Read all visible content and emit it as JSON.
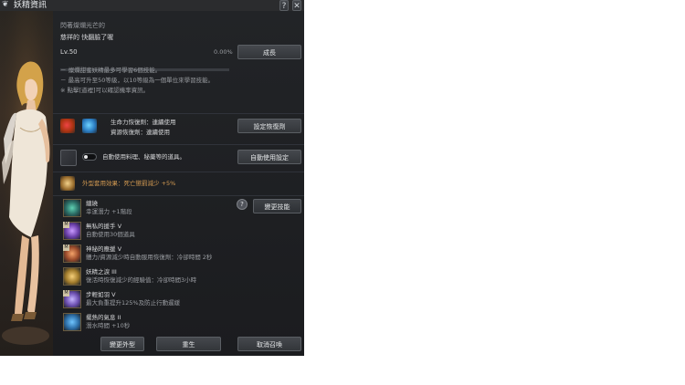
{
  "window": {
    "title": "妖精資訊",
    "help_label": "?",
    "close_label": "✕"
  },
  "header": {
    "line1": "閃著燦爛光芒的",
    "line2": "慈祥的 快翻臉了喔",
    "level": "Lv.50",
    "exp_percent": "0.00%",
    "exp_fraction": 0.0,
    "grow_button": "成長"
  },
  "info_lines": [
    "－ 燦爛甜蜜妖精最多可學習6個技能。",
    "－ 最高可升至50等級，以10等級為一個單位來學習技能。",
    "※ 點擊[道裡]可以確認機率資訊。"
  ],
  "potion": {
    "hp_label": "生命力恢復劑：連續使用",
    "mp_label": "資源恢復劑：連續使用",
    "set_button": "設定恢復劑"
  },
  "auto_use": {
    "label": "自動使用料理、秘藥等的道具。",
    "button": "自動使用設定"
  },
  "appearance": {
    "label": "外型套用效果：死亡懲罰減少 +5%"
  },
  "skills_help": "?",
  "change_skill_button": "變更技能",
  "skills": [
    {
      "name": "纏繞",
      "desc": "幸運潛力 +1階段",
      "marked": false
    },
    {
      "name": "無私的援手 V",
      "desc": "自動使用30個道具",
      "marked": true
    },
    {
      "name": "神秘的應援 V",
      "desc": "體力/資源減少時自動服用恢復劑：冷卻時間 2秒",
      "marked": true
    },
    {
      "name": "妖精之淚 III",
      "desc": "復活時恢復減少的經驗值：冷卻時間3小時",
      "marked": false
    },
    {
      "name": "步輕如羽 V",
      "desc": "最大負重提升125%及防止行動遲緩",
      "marked": true
    },
    {
      "name": "擺熱的氣息 II",
      "desc": "潛水時間 +10秒",
      "marked": false
    }
  ],
  "footer": {
    "change_appearance": "變更外型",
    "rebirth": "重生",
    "cancel_summon": "取消召喚"
  },
  "colors": {
    "window_bg": "#1d1f22",
    "button_bg": "#3e4146",
    "gold_text": "#d7b46a",
    "orange_text": "#d49b52"
  }
}
